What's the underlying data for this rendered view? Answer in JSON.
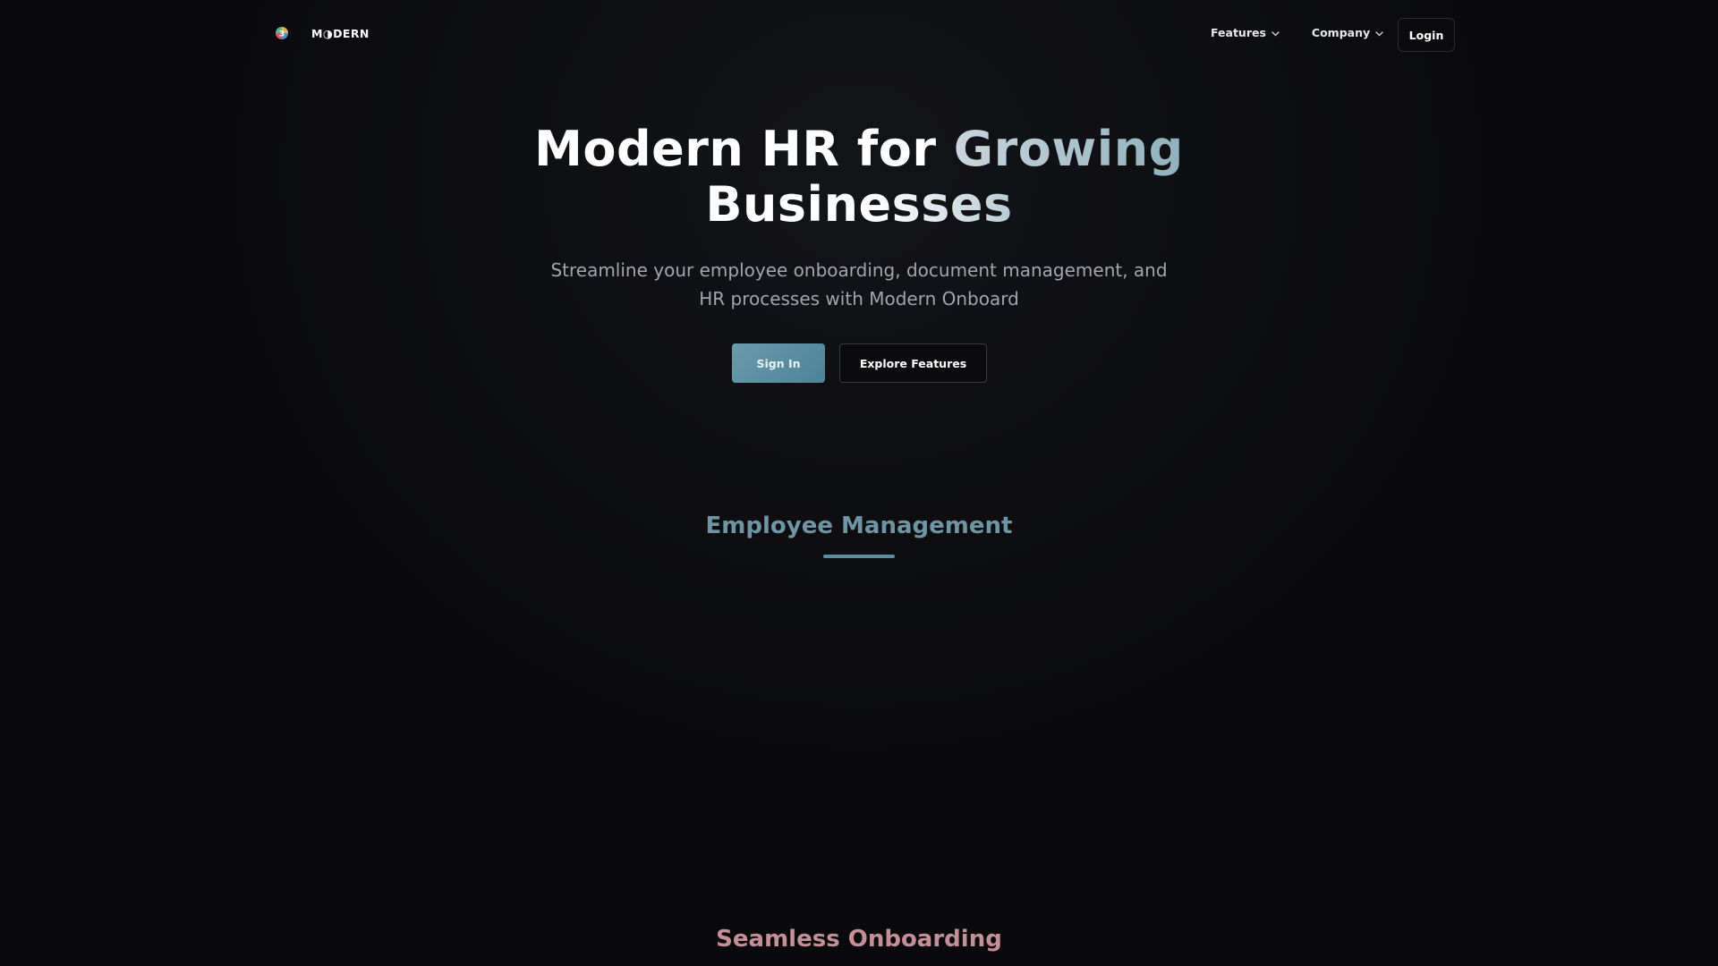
{
  "nav": {
    "brand_text": "M◑DERN",
    "brand_logo_icon": "modern-logo-icon",
    "menu": [
      {
        "label": "Features",
        "icon": "chevron-down-icon"
      },
      {
        "label": "Company",
        "icon": "chevron-down-icon"
      }
    ],
    "login_label": "Login"
  },
  "hero": {
    "title_part1": "Modern HR for ",
    "title_part2": "Growing",
    "title_part3": "Businesses",
    "subtitle_line1": "Streamline your employee onboarding, document management, and",
    "subtitle_line2": "HR processes with Modern Onboard",
    "primary_cta": "Sign In",
    "secondary_cta": "Explore Features"
  },
  "sections": [
    {
      "title": "Employee Management",
      "color": "#6f94a3"
    },
    {
      "title": "Seamless Onboarding",
      "color": "#c48f96"
    }
  ],
  "colors": {
    "background": "#0a0a0c",
    "accent_teal": "#5f8da0",
    "accent_rose": "#c48f96",
    "subtitle_gray": "#a3a5ab"
  }
}
